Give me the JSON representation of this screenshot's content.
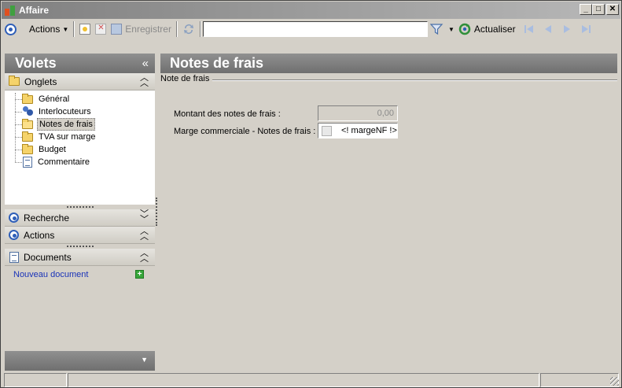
{
  "window": {
    "title": "Affaire",
    "controls": {
      "minimize": "_",
      "maximize": "□",
      "close": "✕"
    }
  },
  "toolbar": {
    "actions_label": "Actions",
    "save_label": "Enregistrer",
    "search_value": "",
    "refresh_label": "Actualiser",
    "accent_color": "#2f5fb8"
  },
  "sidebar": {
    "title": "Volets",
    "collapse_glyph": "«",
    "onglets": {
      "label": "Onglets",
      "chevron": "⌃⌃",
      "items": [
        {
          "label": "Général",
          "icon": "folder-icon"
        },
        {
          "label": "Interlocuteurs",
          "icon": "people-icon"
        },
        {
          "label": "Notes de frais",
          "icon": "folder-open-icon",
          "selected": true
        },
        {
          "label": "TVA sur marge",
          "icon": "folder-icon"
        },
        {
          "label": "Budget",
          "icon": "folder-icon"
        },
        {
          "label": "Commentaire",
          "icon": "note-icon"
        }
      ]
    },
    "recherche": {
      "label": "Recherche",
      "chevron": "⌄⌄"
    },
    "actions": {
      "label": "Actions",
      "chevron": "⌃⌃"
    },
    "documents": {
      "label": "Documents",
      "chevron": "⌃⌃",
      "new_link": "Nouveau document"
    }
  },
  "main": {
    "title": "Notes de frais",
    "group_title": "Note de frais",
    "fields": {
      "montant_label": "Montant des notes de frais :",
      "montant_value": "0,00",
      "marge_label": "Marge commerciale - Notes de frais  :",
      "marge_value": "<! margeNF !>"
    }
  }
}
